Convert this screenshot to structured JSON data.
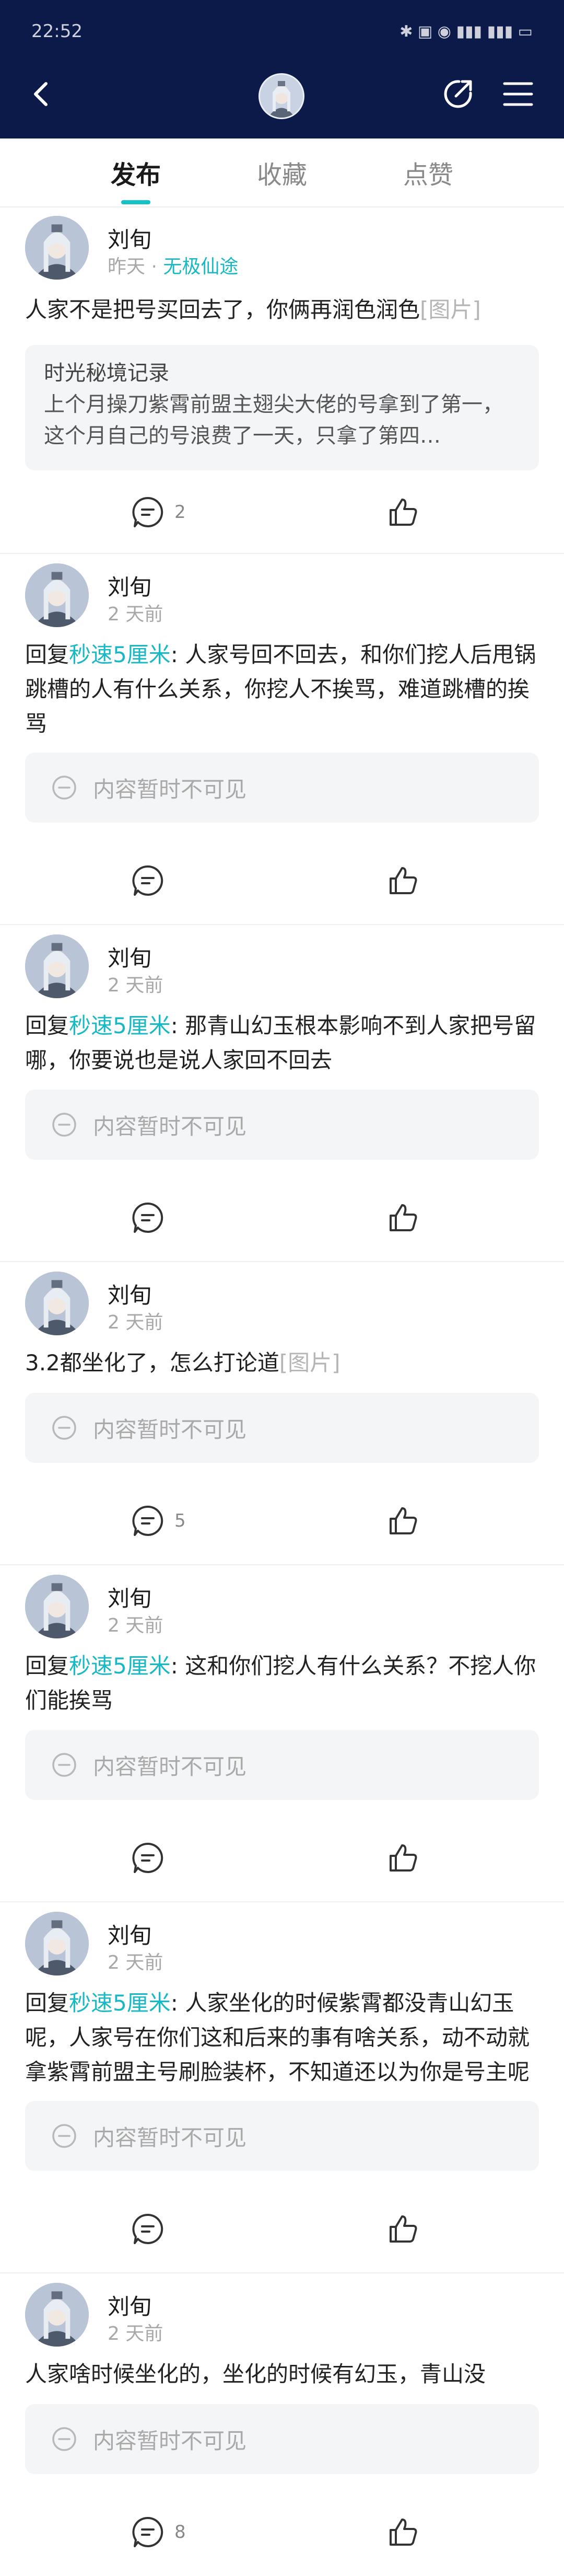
{
  "statusbar": {
    "time": "22:52",
    "icons_text": "✱ ▣ ◉ ▮▮▮ ▮▮▮ ▭"
  },
  "header": {
    "icons": [
      "back-icon",
      "share-icon",
      "menu-icon"
    ]
  },
  "tabs": [
    {
      "label": "发布",
      "active": true
    },
    {
      "label": "收藏",
      "active": false
    },
    {
      "label": "点赞",
      "active": false
    }
  ],
  "common": {
    "hidden_text": "内容暂时不可见",
    "image_tag": "[图片]"
  },
  "posts": [
    {
      "author": "刘旬",
      "time": "昨天",
      "topic": "无极仙途",
      "text": "人家不是把号买回去了，你俩再润色润色",
      "quote_title": "时光秘境记录",
      "quote_body": "上个月操刀紫霄前盟主翅尖大佬的号拿到了第一，这个月自己的号浪费了一天，只拿了第四…",
      "comments": "2"
    },
    {
      "author": "刘旬",
      "time": "2 天前",
      "reply_prefix": "回复",
      "mention": "秒速5厘米",
      "text": ": 人家号回不回去，和你们挖人后甩锅跳槽的人有什么关系，你挖人不挨骂，难道跳槽的挨骂"
    },
    {
      "author": "刘旬",
      "time": "2 天前",
      "reply_prefix": "回复",
      "mention": "秒速5厘米",
      "text": ": 那青山幻玉根本影响不到人家把号留哪，你要说也是说人家回不回去"
    },
    {
      "author": "刘旬",
      "time": "2 天前",
      "text": "3.2都坐化了，怎么打论道",
      "comments": "5"
    },
    {
      "author": "刘旬",
      "time": "2 天前",
      "reply_prefix": "回复",
      "mention": "秒速5厘米",
      "text": ": 这和你们挖人有什么关系？不挖人你们能挨骂"
    },
    {
      "author": "刘旬",
      "time": "2 天前",
      "reply_prefix": "回复",
      "mention": "秒速5厘米",
      "text": ": 人家坐化的时候紫霄都没青山幻玉呢，人家号在你们这和后来的事有啥关系，动不动就拿紫霄前盟主号刷脸装杯，不知道还以为你是号主呢"
    },
    {
      "author": "刘旬",
      "time": "2 天前",
      "text": "人家啥时候坐化的，坐化的时候有幻玉，青山没",
      "comments": "8"
    }
  ]
}
